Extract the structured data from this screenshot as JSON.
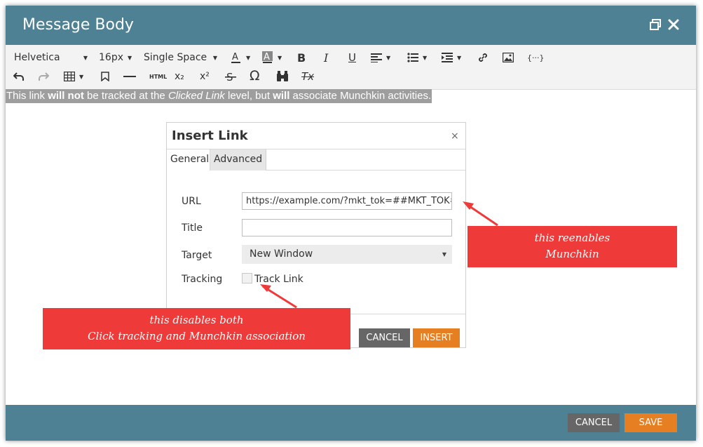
{
  "window": {
    "title": "Message Body",
    "restore_icon": "restore-window-icon",
    "close_icon": "close-icon"
  },
  "toolbar": {
    "font_family": "Helvetica",
    "font_size": "16px",
    "line_spacing": "Single Space",
    "icons_row1": [
      "font-color-icon",
      "background-color-icon",
      "bold-icon",
      "italic-icon",
      "underline-icon",
      "align-icon",
      "bullet-list-icon",
      "indent-icon",
      "link-icon",
      "image-icon",
      "code-snippet-icon"
    ],
    "icons_row2": [
      "undo-icon",
      "redo-icon",
      "table-icon",
      "bookmark-icon",
      "horizontal-rule-icon",
      "html-icon",
      "subscript-icon",
      "superscript-icon",
      "strikethrough-icon",
      "special-character-icon",
      "find-icon",
      "clear-format-icon"
    ],
    "html_label": "HTML",
    "bold_label": "B",
    "italic_label": "I",
    "underline_label": "U",
    "omega_label": "Ω",
    "subscript_label": "x₂",
    "superscript_label": "x²",
    "clear_label": "Tx"
  },
  "content": {
    "part1": "This link ",
    "bold1": "will not",
    "part2": " be tracked at the ",
    "italic1": "Clicked Link",
    "part3": " level, but ",
    "bold2": "will",
    "part4": " associate Munchkin activities."
  },
  "insert_link": {
    "title": "Insert Link",
    "close_label": "×",
    "tabs": [
      "General",
      "Advanced"
    ],
    "url_label": "URL",
    "url_value": "https://example.com/?mkt_tok=##MKT_TOK##",
    "title_label": "Title",
    "title_value": "",
    "target_label": "Target",
    "target_value": "New Window",
    "tracking_label": "Tracking",
    "track_link_label": "Track Link",
    "track_link_checked": false,
    "cancel_label": "CANCEL",
    "insert_label": "INSERT"
  },
  "annotations": {
    "reenables_line1": "this reenables",
    "reenables_line2": "Munchkin",
    "disables_line1": "this disables both",
    "disables_line2": "Click tracking and Munchkin association"
  },
  "footer": {
    "cancel_label": "CANCEL",
    "save_label": "SAVE"
  },
  "colors": {
    "header": "#4e8194",
    "accent_orange": "#e67e22",
    "button_gray": "#666666",
    "callout_red": "#ef3a3a"
  }
}
